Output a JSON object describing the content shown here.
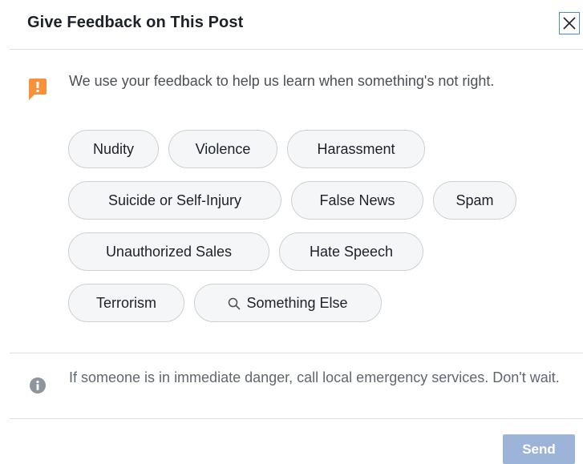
{
  "dialog": {
    "title": "Give Feedback on This Post",
    "close_icon": "close-icon"
  },
  "info": {
    "icon": "exclamation-flag-icon",
    "icon_color": "#f7923b",
    "text": "We use your feedback to help us learn when something's not right."
  },
  "options": [
    {
      "label": "Nudity"
    },
    {
      "label": "Violence"
    },
    {
      "label": "Harassment"
    },
    {
      "label": "Suicide or Self-Injury"
    },
    {
      "label": "False News"
    },
    {
      "label": "Spam"
    },
    {
      "label": "Unauthorized Sales"
    },
    {
      "label": "Hate Speech"
    },
    {
      "label": "Terrorism"
    },
    {
      "label": "Something Else",
      "icon": "search-icon"
    }
  ],
  "notice": {
    "icon": "info-icon",
    "text": "If someone is in immediate danger, call local emergency services. Don't wait."
  },
  "footer": {
    "send_label": "Send",
    "send_color": "#9cb4d8"
  }
}
